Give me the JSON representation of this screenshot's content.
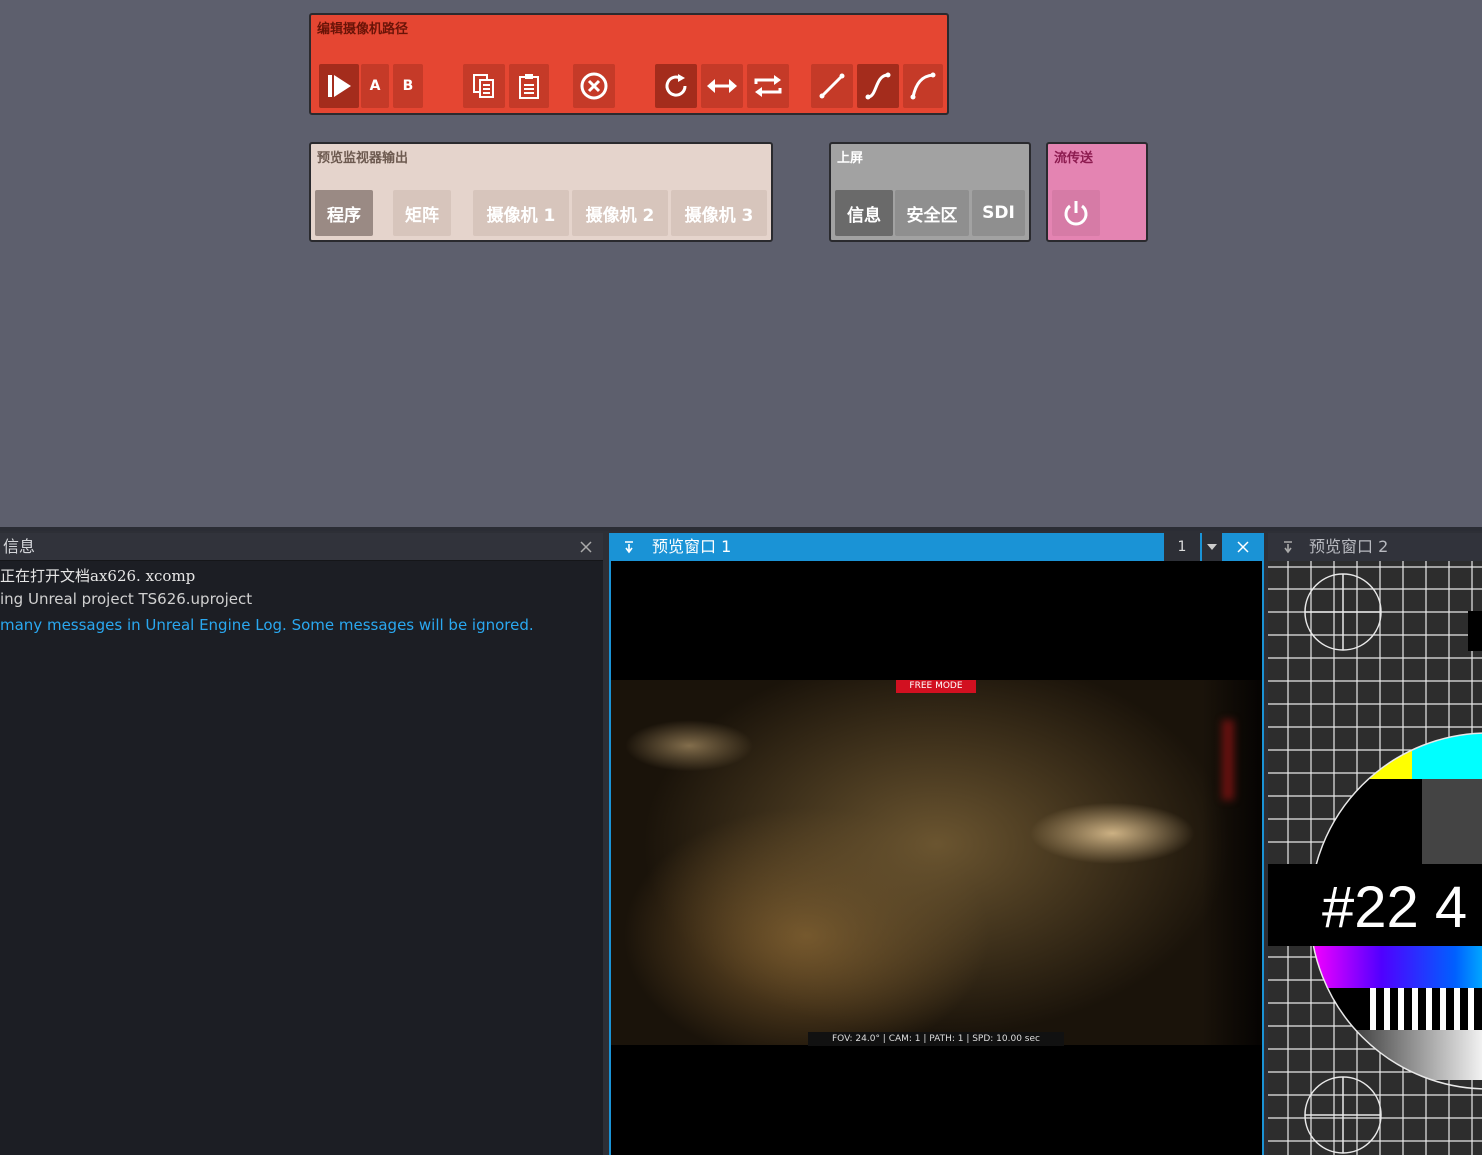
{
  "path_panel": {
    "title": "编辑摄像机路径",
    "a_label": "A",
    "b_label": "B"
  },
  "monitor_panel": {
    "title": "预览监视器输出",
    "buttons": [
      "程序",
      "矩阵",
      "摄像机 1",
      "摄像机 2",
      "摄像机 3"
    ],
    "active": "程序"
  },
  "screen_panel": {
    "title": "上屏",
    "buttons": [
      "信息",
      "安全区",
      "SDI"
    ],
    "active": "信息"
  },
  "stream_panel": {
    "title": "流传送"
  },
  "info_pane": {
    "title": "信息",
    "lines": [
      {
        "text": "正在打开文档ax626. xcomp",
        "color": "#e6e6e6"
      },
      {
        "text": "ing Unreal project TS626.uproject",
        "color": "#d0d0d0"
      },
      {
        "text": "many messages in Unreal Engine Log. Some messages will be ignored.",
        "color": "#2aa8f0"
      }
    ]
  },
  "preview1": {
    "title": "预览窗口 1",
    "number": "1",
    "mode_badge": "FREE MODE",
    "status_text": "FOV: 24.0° | CAM: 1 | PATH: 1 | SPD: 10.00 sec"
  },
  "preview2": {
    "title": "预览窗口 2",
    "test_card_label": "#22 4"
  },
  "colors": {
    "path_panel": "#e54632",
    "monitor_panel": "#e5d4cc",
    "screen_panel": "#a2a2a2",
    "stream_panel": "#e484b2",
    "active_tab": "#1a93d6",
    "background": "#5d5f6d"
  }
}
